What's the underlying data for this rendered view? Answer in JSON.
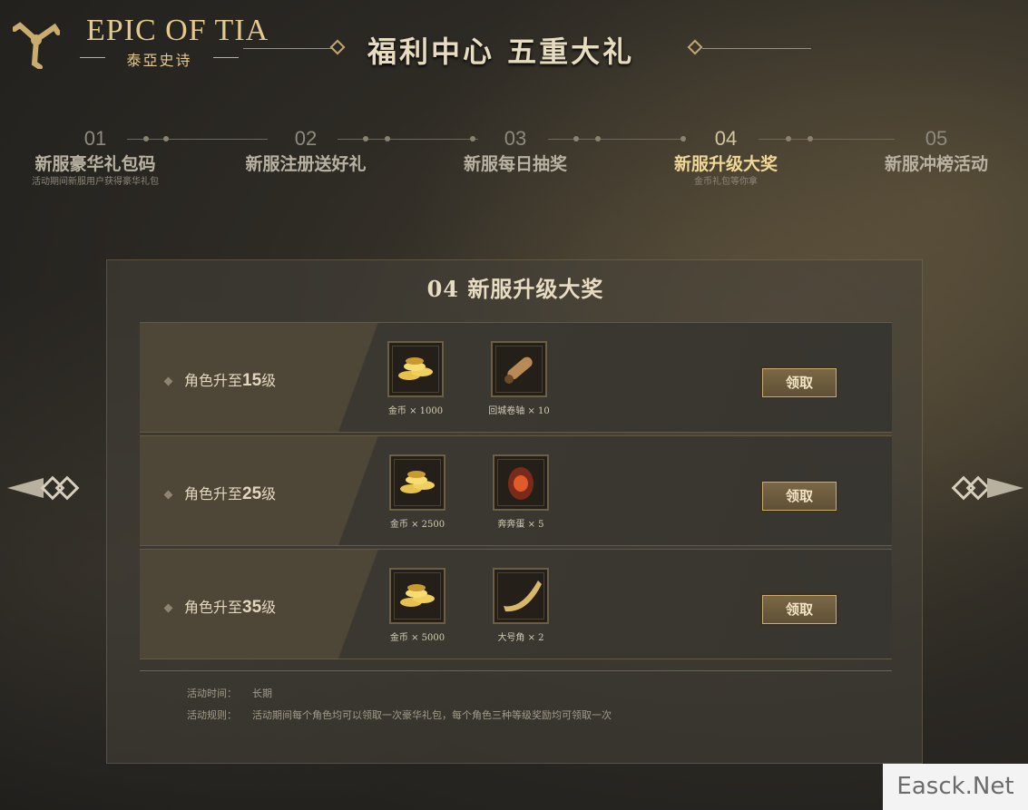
{
  "logo": {
    "title": "EPIC OF TIA",
    "subtitle": "泰亞史诗"
  },
  "header": {
    "title": "福利中心  五重大礼"
  },
  "steps": [
    {
      "num": "01",
      "title": "新服豪华礼包码",
      "sub": "活动期间新服用户获得豪华礼包"
    },
    {
      "num": "02",
      "title": "新服注册送好礼",
      "sub": ""
    },
    {
      "num": "03",
      "title": "新服每日抽奖",
      "sub": ""
    },
    {
      "num": "04",
      "title": "新服升级大奖",
      "sub": "金币礼包等你拿",
      "active": true
    },
    {
      "num": "05",
      "title": "新服冲榜活动",
      "sub": ""
    }
  ],
  "panel": {
    "title": "04  新服升级大奖",
    "rows": [
      {
        "label_prefix": "角色升至",
        "level": "15",
        "label_suffix": "级",
        "items": [
          {
            "icon": "gold-coins-icon",
            "caption": "金币 × 1000"
          },
          {
            "icon": "scroll-icon",
            "caption": "回城卷轴 × 10"
          }
        ],
        "button": "领取"
      },
      {
        "label_prefix": "角色升至",
        "level": "25",
        "label_suffix": "级",
        "items": [
          {
            "icon": "gold-coins-icon",
            "caption": "金币 × 2500"
          },
          {
            "icon": "egg-icon",
            "caption": "奔奔蛋 × 5"
          }
        ],
        "button": "领取"
      },
      {
        "label_prefix": "角色升至",
        "level": "35",
        "label_suffix": "级",
        "items": [
          {
            "icon": "gold-coins-icon",
            "caption": "金币 × 5000"
          },
          {
            "icon": "horn-icon",
            "caption": "大号角 × 2"
          }
        ],
        "button": "领取"
      }
    ],
    "info": {
      "time_label": "活动时间：",
      "time_value": "长期",
      "rule_label": "活动规则：",
      "rule_value": "活动期间每个角色均可以领取一次豪华礼包，每个角色三种等级奖励均可领取一次"
    }
  },
  "watermark": "Easck.Net",
  "colors": {
    "accent": "#e5c98a",
    "active": "#f0d796"
  }
}
